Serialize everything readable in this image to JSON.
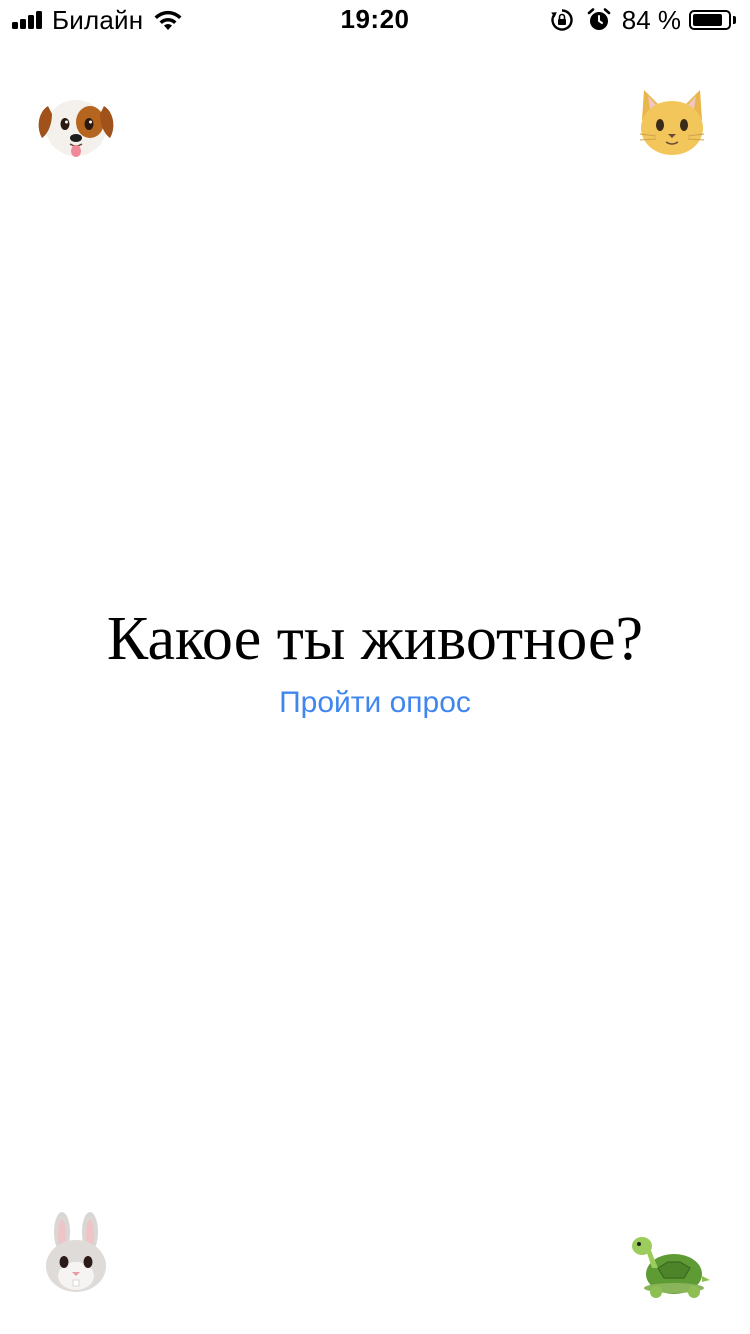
{
  "status_bar": {
    "carrier": "Билайн",
    "time": "19:20",
    "battery_percent": "84 %",
    "battery_level": 0.84,
    "icons": [
      "signal-icon",
      "wifi-icon",
      "rotation-lock-icon",
      "alarm-icon",
      "battery-icon"
    ]
  },
  "corners": {
    "top_left": "dog-icon",
    "top_right": "cat-icon",
    "bottom_left": "rabbit-icon",
    "bottom_right": "turtle-icon"
  },
  "main": {
    "question": "Какое ты животное?",
    "cta_label": "Пройти опрос"
  },
  "colors": {
    "background": "#ffffff",
    "text": "#000000",
    "link": "#3f86ef"
  }
}
